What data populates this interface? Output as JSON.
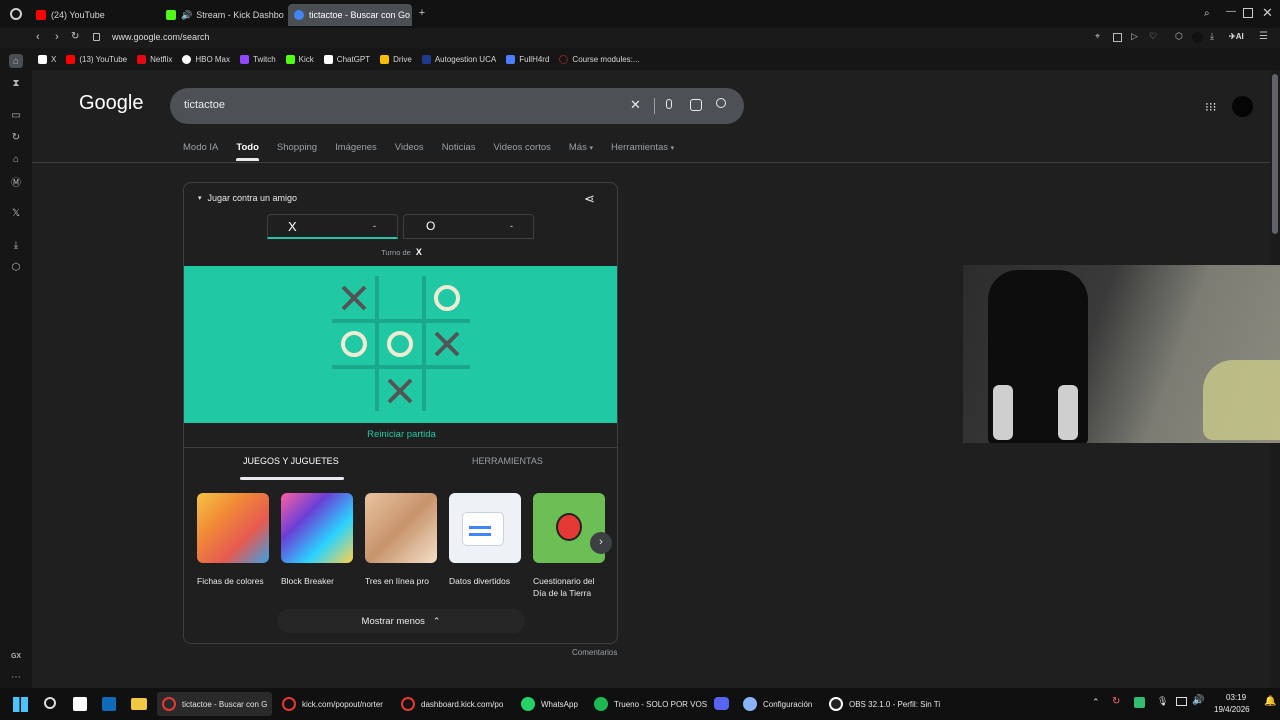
{
  "browser": {
    "tabs": [
      {
        "label": "(24) YouTube",
        "color": "#ff0000"
      },
      {
        "label": "Stream - Kick Dashbo",
        "color": "#53fc18"
      },
      {
        "label": "tictactoe - Buscar con Go",
        "color": "#4285f4"
      }
    ],
    "url": "www.google.com/search"
  },
  "bookmarks": [
    {
      "label": "X",
      "color": "#ffffff"
    },
    {
      "label": "(13) YouTube",
      "color": "#ff0000"
    },
    {
      "label": "Netflix",
      "color": "#e50914"
    },
    {
      "label": "HBO Max",
      "color": "#ffffff"
    },
    {
      "label": "Twitch",
      "color": "#9146ff"
    },
    {
      "label": "Kick",
      "color": "#53fc18"
    },
    {
      "label": "ChatGPT",
      "color": "#ffffff"
    },
    {
      "label": "Drive",
      "color": "#fbbc04"
    },
    {
      "label": "Autogestion UCA",
      "color": "#1e3a8a"
    },
    {
      "label": "FullH4rd",
      "color": "#4d7cff"
    },
    {
      "label": "Course modules:...",
      "color": "#e53935"
    }
  ],
  "sidebar": {
    "bottom_label": "GX"
  },
  "google": {
    "logo": "Google",
    "query": "tictactoe",
    "filters": [
      "Modo IA",
      "Todo",
      "Shopping",
      "Imágenes",
      "Videos",
      "Noticias",
      "Videos cortos",
      "Más",
      "Herramientas"
    ]
  },
  "game": {
    "mode_label": "Jugar contra un amigo",
    "player_x": "X",
    "player_x_score": "-",
    "player_o": "O",
    "player_o_score": "-",
    "turn_label": "Turno de",
    "turn_symbol": "X",
    "board": [
      "X",
      "",
      "O",
      "O",
      "O",
      "X",
      "",
      "X",
      ""
    ],
    "restart_label": "Reiniciar partida",
    "tabs": [
      "JUEGOS Y JUGUETES",
      "HERRAMIENTAS"
    ],
    "tiles": [
      {
        "label": "Fichas de colores"
      },
      {
        "label": "Block Breaker"
      },
      {
        "label": "Tres en línea pro"
      },
      {
        "label": "Datos divertidos"
      },
      {
        "label": "Cuestionario del Día de la Tierra"
      }
    ],
    "show_less_label": "Mostrar menos",
    "feedback_label": "Comentarios"
  },
  "taskbar": {
    "apps": [
      {
        "label": "tictactoe - Buscar con G",
        "color": "#e53935"
      },
      {
        "label": "kick.com/popout/norter",
        "color": "#e53935"
      },
      {
        "label": "dashboard.kick.com/po",
        "color": "#e53935"
      },
      {
        "label": "WhatsApp",
        "color": "#25d366"
      },
      {
        "label": "Trueno - SOLO POR VOS",
        "color": "#1db954"
      },
      {
        "label": "Configuración",
        "color": "#8ab4f8"
      },
      {
        "label": "OBS 32.1.0 - Perfil: Sin Ti",
        "color": "#ffffff"
      }
    ],
    "time": "03:19",
    "date": "19/4/2026"
  }
}
